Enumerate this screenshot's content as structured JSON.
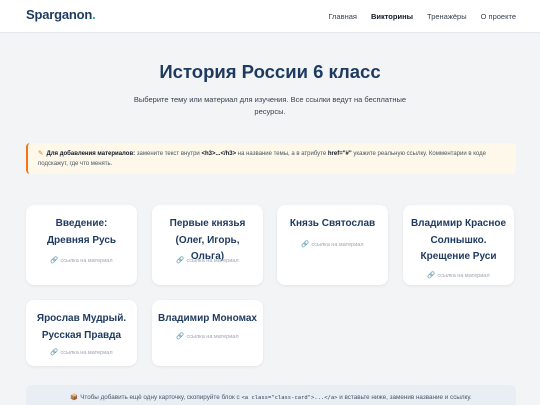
{
  "header": {
    "logo": "Sparganon",
    "logo_dot": ".",
    "nav": [
      "Главная",
      "Викторины",
      "Тренажёры",
      "О проекте"
    ]
  },
  "hero": {
    "title": "История России 6 класс",
    "subtitle": "Выберите тему или материал для изучения. Все ссылки ведут на бесплатные ресурсы."
  },
  "notice": {
    "icon": "pencil-icon",
    "bold": "Для добавления материалов:",
    "text1": " замените текст внутри ",
    "code1": "<h3>...</h3>",
    "text2": " на название темы, а в атрибуте ",
    "code2": "href=\"#\"",
    "text3": " укажите реальную ссылку. Комментарии в коде подскажут, где что менять."
  },
  "cards": [
    {
      "title": "Введение: Древняя Русь",
      "link": "ссылка на материал"
    },
    {
      "title": "Первые князья (Олег, Игорь, Ольга)",
      "link": "ссылка на материал"
    },
    {
      "title": "Князь Святослав",
      "link": "ссылка на материал"
    },
    {
      "title": "Владимир Красное Солнышко. Крещение Руси",
      "link": "ссылка на материал"
    },
    {
      "title": "Ярослав Мудрый. Русская Правда",
      "link": "ссылка на материал"
    },
    {
      "title": "Владимир Мономах",
      "link": "ссылка на материал"
    }
  ],
  "tip": {
    "icon": "package-icon",
    "text1": "Чтобы добавить ещё одну карточку, скопируйте блок с ",
    "code": "<a class=\"class-card\">...</a>",
    "text2": " и вставьте ниже, заменив название и ссылку."
  },
  "colors": {
    "accent": "#f97316",
    "brand": "#1e3a5f",
    "logo_dot": "#14b8a6"
  }
}
